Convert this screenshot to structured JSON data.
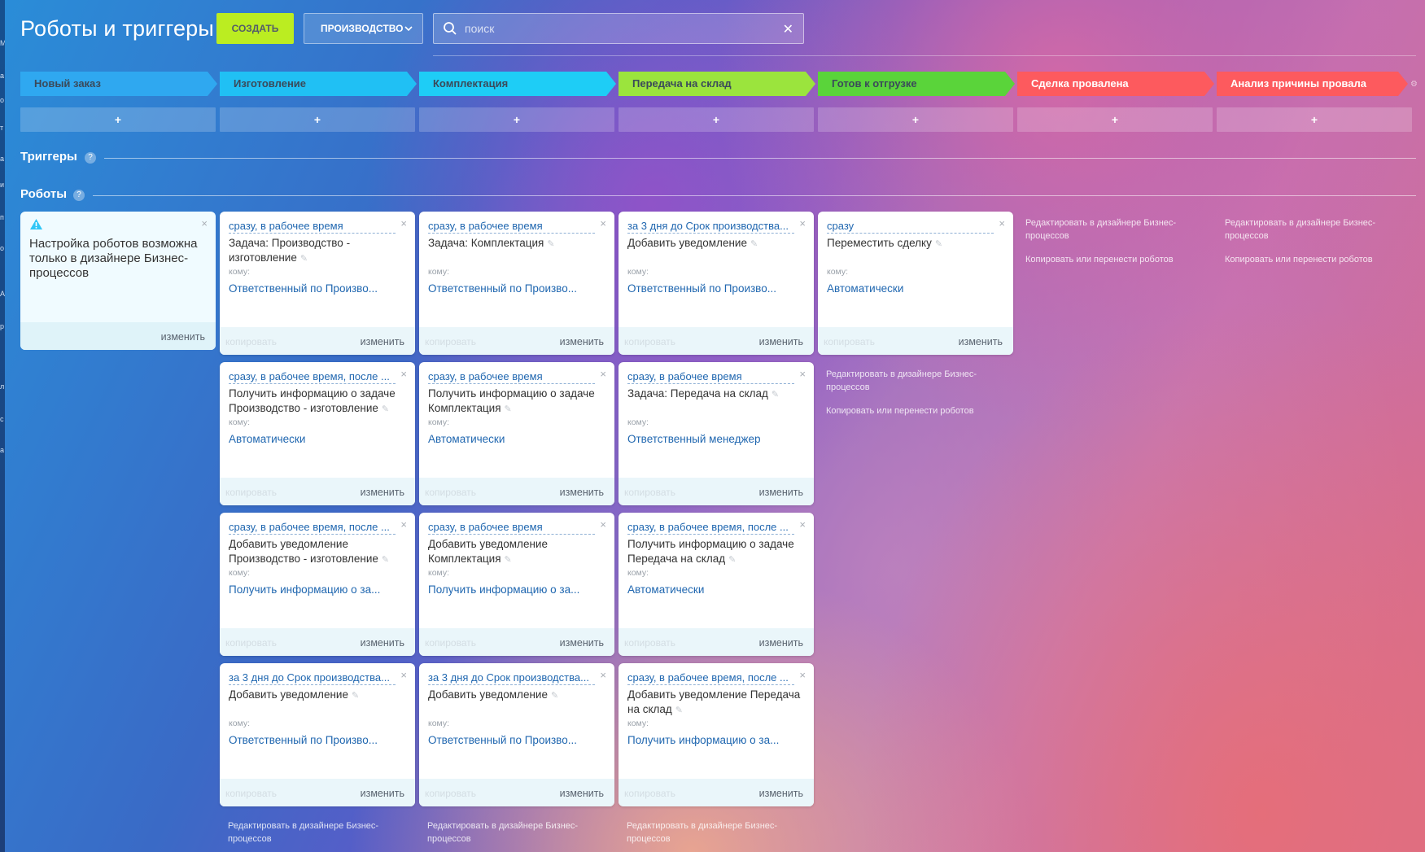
{
  "header": {
    "title": "Роботы и триггеры",
    "create_label": "СОЗДАТЬ",
    "category_label": "ПРОИЗВОДСТВО",
    "search_placeholder": "поиск"
  },
  "left_strip": [
    "М",
    "а",
    "о",
    "т",
    "а",
    "и",
    "п",
    "о",
    "А",
    "р",
    "л",
    "с",
    "а"
  ],
  "stages": [
    {
      "label": "Новый заказ",
      "color": "#2fa8f0"
    },
    {
      "label": "Изготовление",
      "color": "#20c0f4"
    },
    {
      "label": "Комплектация",
      "color": "#1ecdf6"
    },
    {
      "label": "Передача на склад",
      "color": "#9be43d"
    },
    {
      "label": "Готов к отгрузке",
      "color": "#5ad43a"
    },
    {
      "label": "Сделка провалена",
      "color": "#fd5a5e"
    },
    {
      "label": "Анализ причины провала",
      "color": "#fd5a5e"
    }
  ],
  "add_label": "+",
  "sections": {
    "triggers": "Триггеры",
    "robots": "Роботы",
    "help": "?"
  },
  "warning": {
    "text": "Настройка роботов возможна только в дизайнере Бизнес-процессов",
    "edit": "изменить"
  },
  "card_labels": {
    "to": "кому:",
    "copy": "копировать",
    "edit": "изменить",
    "close": "×"
  },
  "columns": [
    {
      "cards": [
        {
          "delay": "сразу, в рабочее время",
          "title": "Задача: Производство - изготовление",
          "to": "Ответственный по Произво..."
        },
        {
          "delay": "сразу, в рабочее время, после ...",
          "title": "Получить информацию о задаче Производство - изготовление",
          "to": "Автоматически"
        },
        {
          "delay": "сразу, в рабочее время, после ...",
          "title": "Добавить уведомление Производство - изготовление",
          "to": "Получить информацию о за..."
        },
        {
          "delay": "за 3 дня до Срок производства...",
          "title": "Добавить уведомление",
          "to": "Ответственный по Произво..."
        }
      ],
      "link_edit": "Редактировать в дизайнере Бизнес-процессов"
    },
    {
      "cards": [
        {
          "delay": "сразу, в рабочее время",
          "title": "Задача: Комплектация",
          "to": "Ответственный по Произво..."
        },
        {
          "delay": "сразу, в рабочее время",
          "title": "Получить информацию о задаче Комплектация",
          "to": "Автоматически"
        },
        {
          "delay": "сразу, в рабочее время",
          "title": "Добавить уведомление Комплектация",
          "to": "Получить информацию о за..."
        },
        {
          "delay": "за 3 дня до Срок производства...",
          "title": "Добавить уведомление",
          "to": "Ответственный по Произво..."
        }
      ],
      "link_edit": "Редактировать в дизайнере Бизнес-процессов"
    },
    {
      "cards": [
        {
          "delay": "за 3 дня до Срок производства...",
          "title": "Добавить уведомление",
          "to": "Ответственный по Произво..."
        },
        {
          "delay": "сразу, в рабочее время",
          "title": "Задача: Передача на склад",
          "to": "Ответственный менеджер"
        },
        {
          "delay": "сразу, в рабочее время, после ...",
          "title": "Получить информацию о задаче Передача на склад",
          "to": "Автоматически"
        },
        {
          "delay": "сразу, в рабочее время, после ...",
          "title": "Добавить уведомление Передача на склад",
          "to": "Получить информацию о за..."
        }
      ],
      "link_edit": "Редактировать в дизайнере Бизнес-процессов"
    },
    {
      "cards": [
        {
          "delay": "сразу",
          "title": "Переместить сделку",
          "to": "Автоматически"
        }
      ],
      "link_edit": "Редактировать в дизайнере Бизнес-процессов",
      "link_copy": "Копировать или перенести роботов"
    },
    {
      "cards": [],
      "link_edit": "Редактировать в дизайнере Бизнес-процессов",
      "link_copy": "Копировать или перенести роботов"
    },
    {
      "cards": [],
      "link_edit": "Редактировать в дизайнере Бизнес-процессов",
      "link_copy": "Копировать или перенести роботов"
    }
  ]
}
